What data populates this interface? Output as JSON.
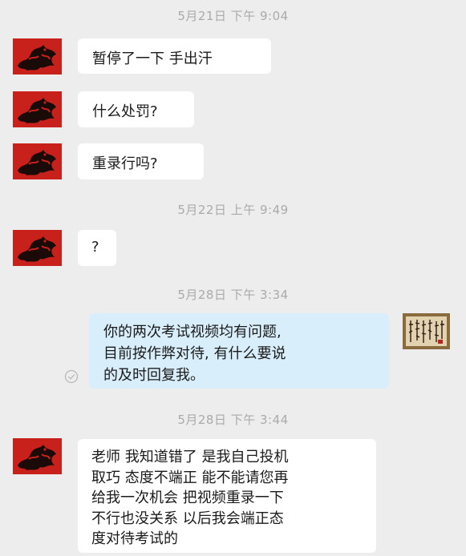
{
  "timestamps": {
    "t1": "5月21日  下午 9:04",
    "t2": "5月22日  上午 9:49",
    "t3": "5月28日  下午 3:34",
    "t4": "5月28日  下午 3:44"
  },
  "messages": [
    {
      "direction": "incoming",
      "lines": [
        "暂停了一下  手出汗"
      ]
    },
    {
      "direction": "incoming",
      "lines": [
        "什么处罚?"
      ]
    },
    {
      "direction": "incoming",
      "lines": [
        "重录行吗?"
      ]
    },
    {
      "direction": "incoming",
      "lines": [
        "?"
      ]
    },
    {
      "direction": "outgoing",
      "lines": [
        "你的两次考试视频均有问题,",
        "目前按作弊对待, 有什么要说",
        "的及时回复我。"
      ]
    },
    {
      "direction": "incoming",
      "lines": [
        "老师 我知道错了 是我自己投机",
        "取巧 态度不端正 能不能请您再",
        "给我一次机会 把视频重录一下",
        "不行也没关系 以后我会端正态",
        "度对待考试的"
      ]
    }
  ],
  "icons": {
    "contact_avatar": "red-dragon-avatar",
    "self_avatar": "calligraphy-avatar",
    "read_status": "check-circle-icon"
  },
  "colors": {
    "background": "#ededed",
    "incoming_bubble": "#ffffff",
    "outgoing_bubble": "#d9eefb",
    "timestamp_text": "#aaaaaa",
    "avatar_red": "#c8201b"
  }
}
